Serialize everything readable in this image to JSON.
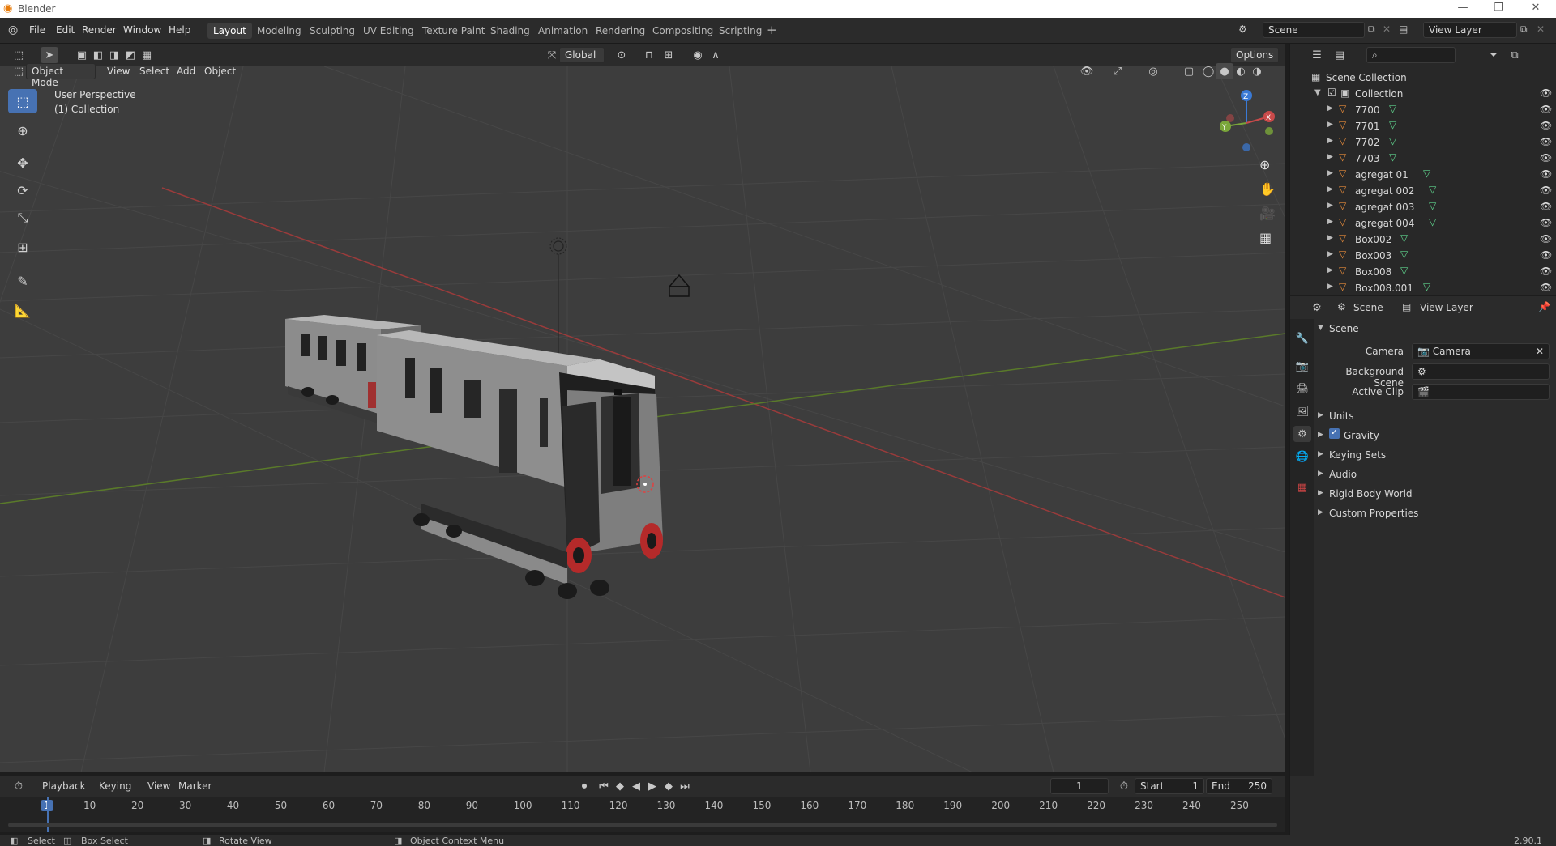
{
  "app": {
    "title": "Blender",
    "version": "2.90.1"
  },
  "menus": [
    "File",
    "Edit",
    "Render",
    "Window",
    "Help"
  ],
  "workspaces": [
    {
      "label": "Layout",
      "active": true
    },
    {
      "label": "Modeling"
    },
    {
      "label": "Sculpting"
    },
    {
      "label": "UV Editing"
    },
    {
      "label": "Texture Paint"
    },
    {
      "label": "Shading"
    },
    {
      "label": "Animation"
    },
    {
      "label": "Rendering"
    },
    {
      "label": "Compositing"
    },
    {
      "label": "Scripting"
    }
  ],
  "scene_field": "Scene",
  "view_layer_field": "View Layer",
  "viewport": {
    "mode": "Object Mode",
    "menus": [
      "View",
      "Select",
      "Add",
      "Object"
    ],
    "orientation": "Global",
    "options": "Options",
    "overlay_title": "User Perspective",
    "overlay_collection": "(1) Collection",
    "axis_labels": {
      "x": "X",
      "y": "Y",
      "z": "Z"
    }
  },
  "outliner": {
    "root": "Scene Collection",
    "collection": "Collection",
    "items": [
      "7700",
      "7701",
      "7702",
      "7703",
      "agregat 01",
      "agregat 002",
      "agregat 003",
      "agregat 004",
      "Box002",
      "Box003",
      "Box008",
      "Box008.001"
    ]
  },
  "properties": {
    "tab_scene": "Scene",
    "tab_view_layer": "View Layer",
    "section": "Scene",
    "camera_label": "Camera",
    "camera_value": "Camera",
    "background_scene_label": "Background Scene",
    "active_clip_label": "Active Clip",
    "panels": [
      "Units",
      "Gravity",
      "Keying Sets",
      "Audio",
      "Rigid Body World",
      "Custom Properties"
    ],
    "gravity_checked": true
  },
  "timeline": {
    "menus": [
      "Playback",
      "Keying",
      "View",
      "Marker"
    ],
    "current_frame": "1",
    "start_label": "Start",
    "start_value": "1",
    "end_label": "End",
    "end_value": "250",
    "ticks": [
      "1",
      "10",
      "20",
      "30",
      "40",
      "50",
      "60",
      "70",
      "80",
      "90",
      "100",
      "110",
      "120",
      "130",
      "140",
      "150",
      "160",
      "170",
      "180",
      "190",
      "200",
      "210",
      "220",
      "230",
      "240",
      "250"
    ]
  },
  "status": {
    "select": "Select",
    "box_select": "Box Select",
    "rotate_view": "Rotate View",
    "context_menu": "Object Context Menu"
  },
  "colors": {
    "accent": "#4772b3",
    "x_axis": "#c94a4a",
    "y_axis": "#7aa63a",
    "z_axis": "#3a7ad6",
    "mesh_icon": "#e48a3a",
    "vertex_icon": "#5fd38d"
  }
}
